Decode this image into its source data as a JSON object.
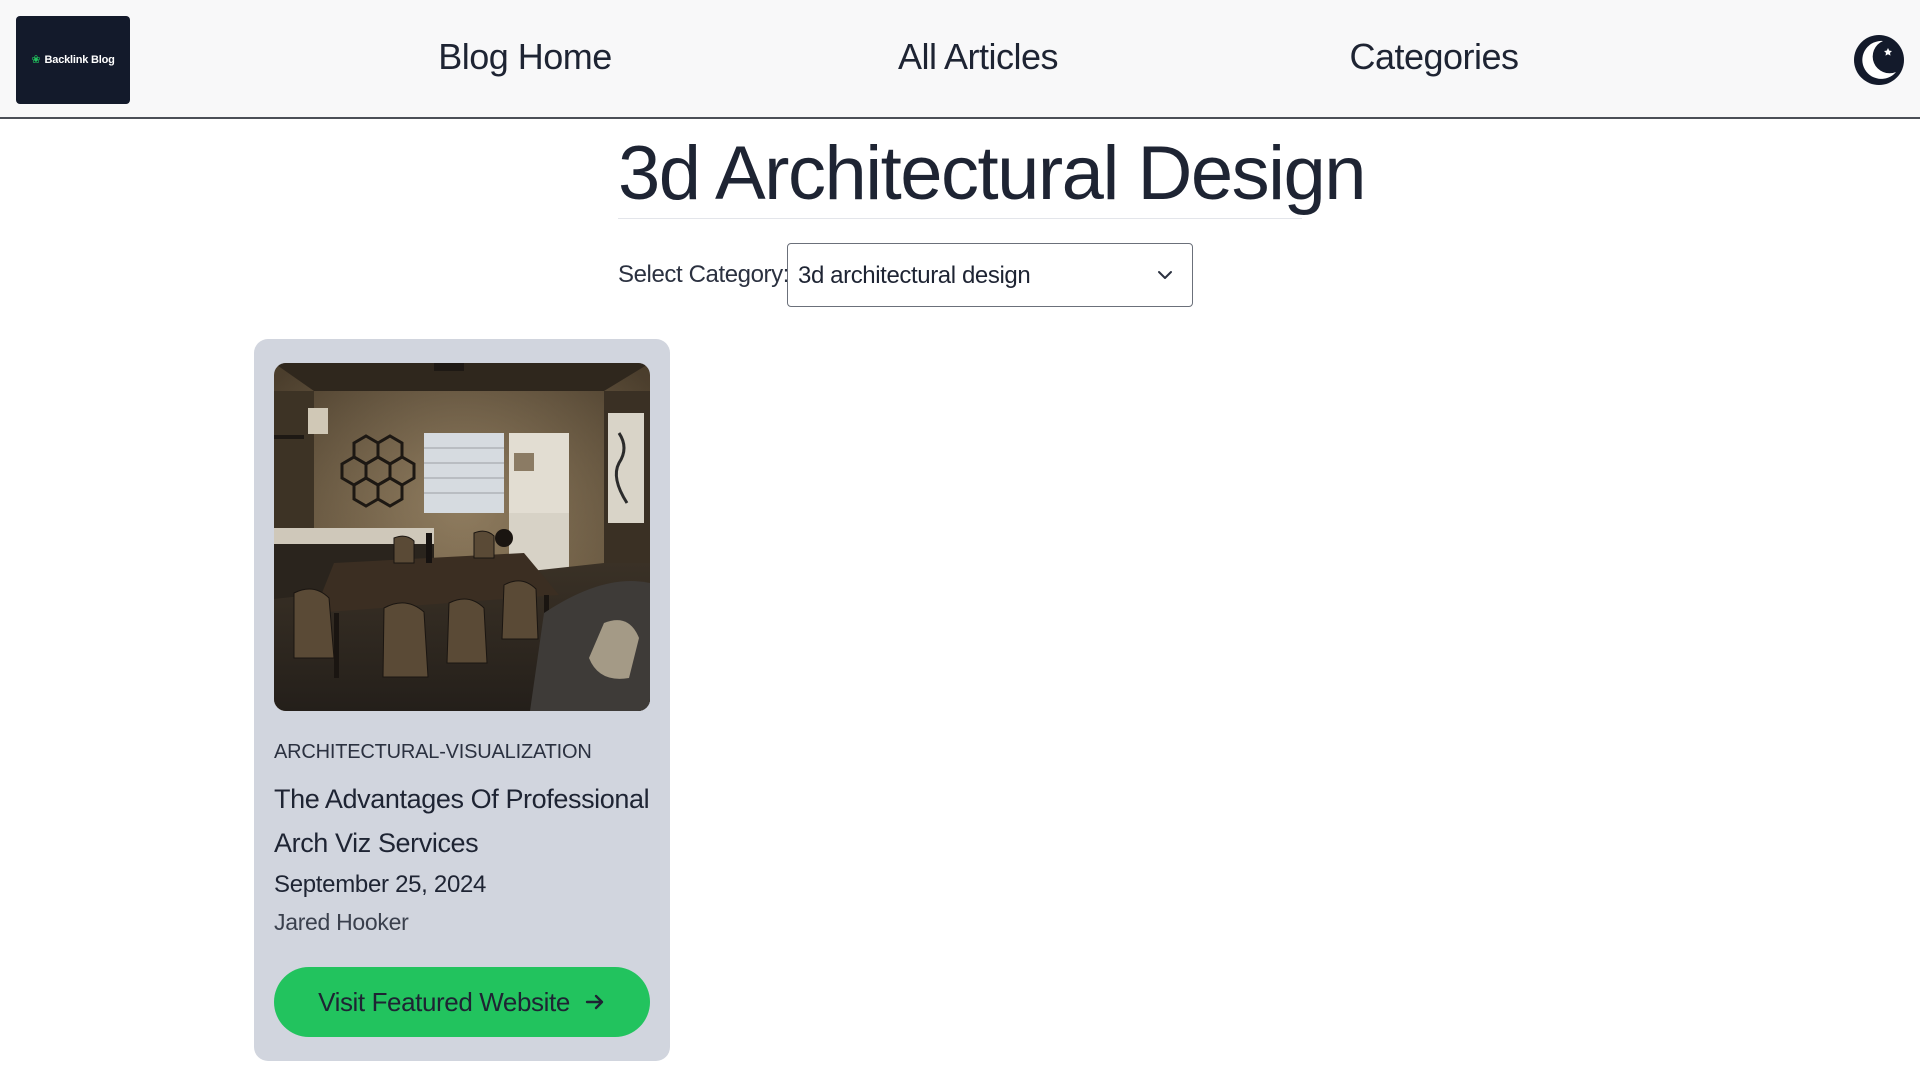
{
  "header": {
    "logo_text": "Backlink Blog",
    "nav": {
      "home": "Blog Home",
      "articles": "All Articles",
      "categories": "Categories"
    },
    "theme_toggle_icon": "moon-icon"
  },
  "page": {
    "title": "3d Architectural Design"
  },
  "category_select": {
    "label": "Select Category:",
    "selected": "3d architectural design"
  },
  "articles": [
    {
      "category": "ARCHITECTURAL-VISUALIZATION",
      "title": "The Advantages Of Professional Arch Viz Services",
      "date": "September 25, 2024",
      "author": "Jared Hooker",
      "button_label": "Visit Featured Website",
      "button_icon": "arrow-right-icon",
      "image_icon": "interior-photo"
    }
  ],
  "colors": {
    "brand_dark": "#131a2b",
    "accent_green": "#22c35e",
    "card_bg": "#d1d5de",
    "header_bg": "#f8f8f9"
  }
}
